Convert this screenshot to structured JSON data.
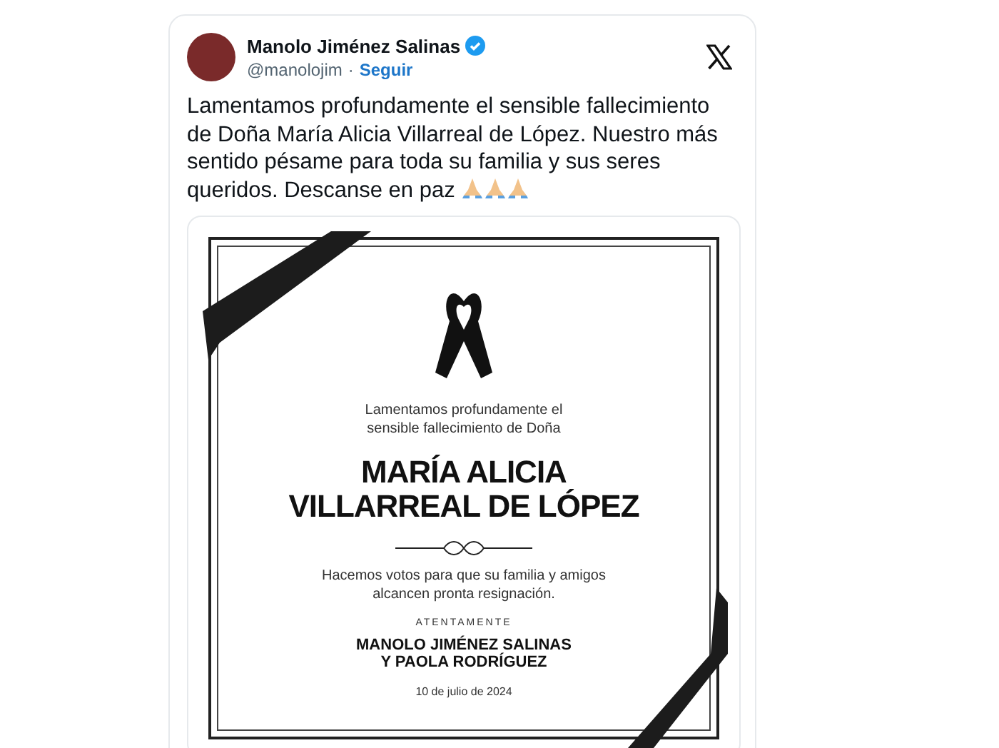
{
  "tweet": {
    "author": {
      "name": "Manolo Jiménez Salinas",
      "verified": true,
      "handle": "@manolojim",
      "separator": "·",
      "follow": "Seguir"
    },
    "text": "Lamentamos profundamente el sensible fallecimiento de Doña María Alicia Villarreal de López. Nuestro más sentido pésame para toda su familia y sus seres queridos. Descanse en paz",
    "card": {
      "intro": "Lamentamos profundamente el sensible fallecimiento de Doña",
      "name_lines": [
        "MARÍA ALICIA",
        "VILLARREAL DE LÓPEZ"
      ],
      "message": "Hacemos votos para que su familia y amigos alcancen pronta resignación.",
      "closing": "ATENTAMENTE",
      "signers": [
        "MANOLO JIMÉNEZ SALINAS",
        "Y PAOLA RODRÍGUEZ"
      ],
      "date": "10 de julio de 2024"
    }
  }
}
